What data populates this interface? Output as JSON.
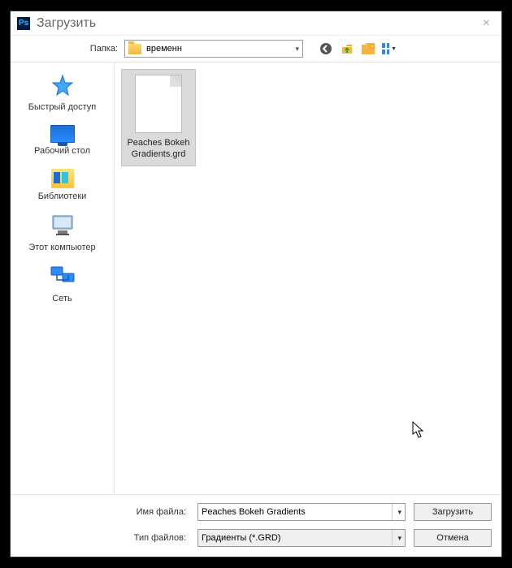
{
  "dialog": {
    "title": "Загрузить",
    "close": "×"
  },
  "toolbar": {
    "folder_label": "Папка:",
    "folder_value": "временн"
  },
  "sidebar": {
    "places": [
      {
        "id": "quick-access",
        "label": "Быстрый доступ"
      },
      {
        "id": "desktop",
        "label": "Рабочий стол"
      },
      {
        "id": "libraries",
        "label": "Библиотеки"
      },
      {
        "id": "this-pc",
        "label": "Этот компьютер"
      },
      {
        "id": "network",
        "label": "Сеть"
      }
    ]
  },
  "filepane": {
    "items": [
      {
        "name": "Peaches Bokeh Gradients.grd"
      }
    ]
  },
  "footer": {
    "filename_label": "Имя файла:",
    "filename_value": "Peaches Bokeh Gradients",
    "filetype_label": "Тип файлов:",
    "filetype_value": "Градиенты (*.GRD)",
    "load_button": "Загрузить",
    "cancel_button": "Отмена"
  }
}
